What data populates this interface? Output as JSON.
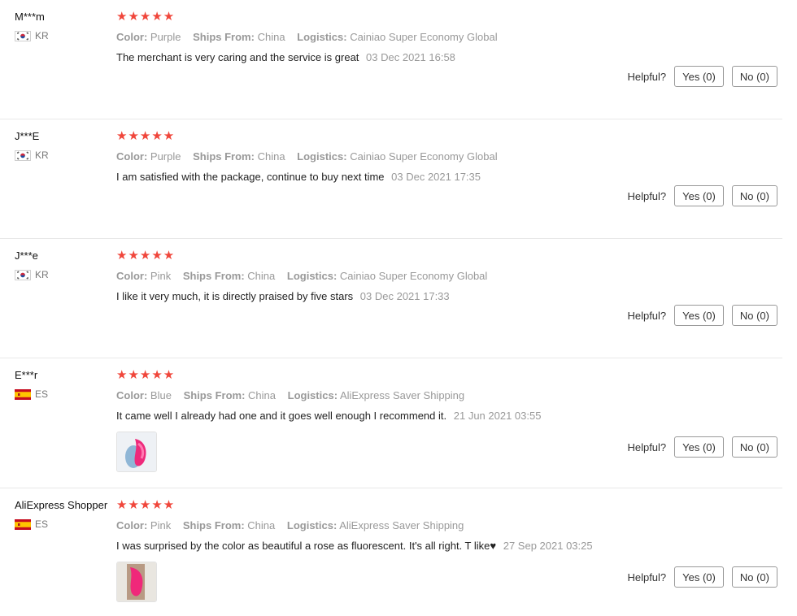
{
  "labels": {
    "color": "Color:",
    "ships_from": "Ships From:",
    "logistics": "Logistics:",
    "helpful": "Helpful?",
    "yes": "Yes (0)",
    "no": "No (0)"
  },
  "colors": {
    "star": "#f0463b",
    "muted_text": "#999999",
    "divider": "#e8e8e8"
  },
  "reviews": [
    {
      "user": "M***m",
      "country": "KR",
      "flag_icon": "south-korea-flag-icon",
      "rating": 5,
      "stars": "★★★★★",
      "color": "Purple",
      "ships_from": "China",
      "logistics": "Cainiao Super Economy Global",
      "text": "The merchant is very caring and the service is great",
      "date": "03 Dec 2021 16:58",
      "has_photo": false
    },
    {
      "user": "J***E",
      "country": "KR",
      "flag_icon": "south-korea-flag-icon",
      "rating": 5,
      "stars": "★★★★★",
      "color": "Purple",
      "ships_from": "China",
      "logistics": "Cainiao Super Economy Global",
      "text": "I am satisfied with the package, continue to buy next time",
      "date": "03 Dec 2021 17:35",
      "has_photo": false
    },
    {
      "user": "J***e",
      "country": "KR",
      "flag_icon": "south-korea-flag-icon",
      "rating": 5,
      "stars": "★★★★★",
      "color": "Pink",
      "ships_from": "China",
      "logistics": "Cainiao Super Economy Global",
      "text": "I like it very much, it is directly praised by five stars",
      "date": "03 Dec 2021 17:33",
      "has_photo": false
    },
    {
      "user": "E***r",
      "country": "ES",
      "flag_icon": "spain-flag-icon",
      "rating": 5,
      "stars": "★★★★★",
      "color": "Blue",
      "ships_from": "China",
      "logistics": "AliExpress Saver Shipping",
      "text": "It came well I already had one and it goes well enough I recommend it.",
      "date": "21 Jun 2021 03:55",
      "has_photo": true
    },
    {
      "user": "AliExpress Shopper",
      "country": "ES",
      "flag_icon": "spain-flag-icon",
      "rating": 5,
      "stars": "★★★★★",
      "color": "Pink",
      "ships_from": "China",
      "logistics": "AliExpress Saver Shipping",
      "text": "I was surprised by the color as beautiful a rose as fluorescent. It's all right. T like♥",
      "date": "27 Sep 2021 03:25",
      "has_photo": true
    }
  ]
}
